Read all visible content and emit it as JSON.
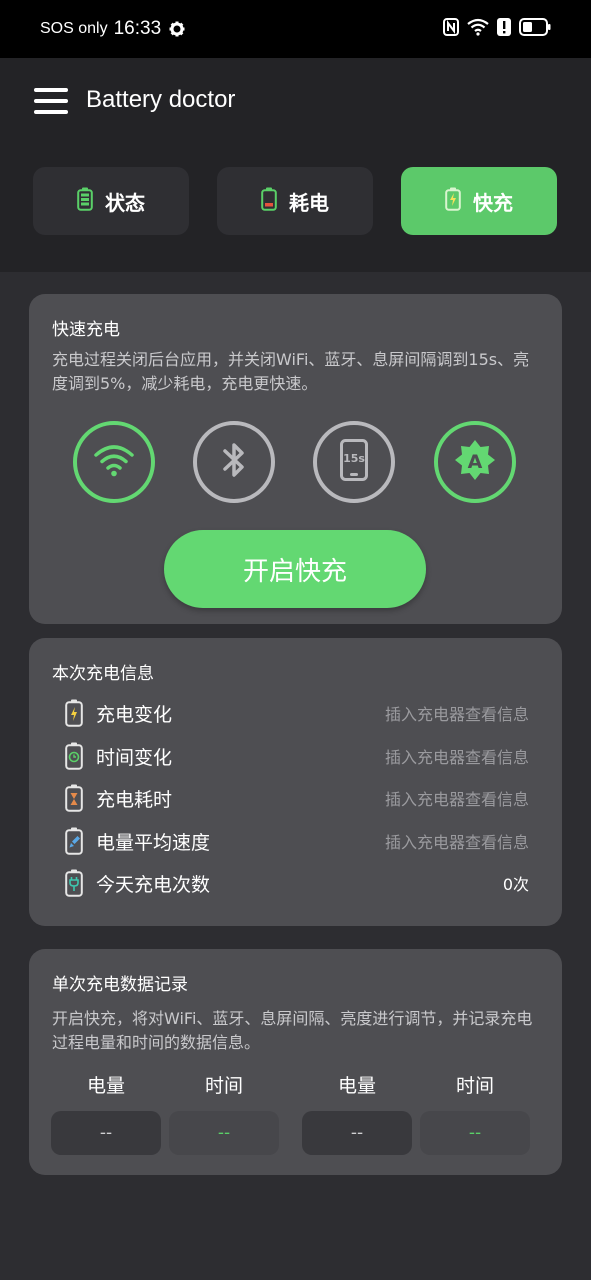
{
  "status_bar": {
    "carrier": "SOS only",
    "time": "16:33"
  },
  "header": {
    "title": "Battery doctor",
    "tabs": [
      {
        "label": "状态",
        "icon": "battery-status-icon",
        "active": false
      },
      {
        "label": "耗电",
        "icon": "battery-drain-icon",
        "active": false
      },
      {
        "label": "快充",
        "icon": "battery-charging-icon",
        "active": true
      }
    ]
  },
  "fast_charge": {
    "title": "快速充电",
    "description": "充电过程关闭后台应用，并关闭WiFi、蓝牙、息屏间隔调到15s、亮度调到5%，减少耗电，充电更快速。",
    "toggles": [
      {
        "name": "wifi-icon",
        "enabled": true
      },
      {
        "name": "bluetooth-icon",
        "enabled": false
      },
      {
        "name": "screen-timeout-icon",
        "label": "15s",
        "enabled": false
      },
      {
        "name": "auto-brightness-icon",
        "label": "A",
        "enabled": true
      }
    ],
    "button_label": "开启快充"
  },
  "charge_info": {
    "title": "本次充电信息",
    "rows": [
      {
        "label": "充电变化",
        "value": "插入充电器查看信息",
        "icon": "battery-bolt-icon"
      },
      {
        "label": "时间变化",
        "value": "插入充电器查看信息",
        "icon": "battery-clock-icon"
      },
      {
        "label": "充电耗时",
        "value": "插入充电器查看信息",
        "icon": "battery-hourglass-icon"
      },
      {
        "label": "电量平均速度",
        "value": "插入充电器查看信息",
        "icon": "battery-rocket-icon"
      },
      {
        "label": "今天充电次数",
        "value": "0次",
        "icon": "battery-plug-icon"
      }
    ]
  },
  "records": {
    "title": "单次充电数据记录",
    "description": "开启快充，将对WiFi、蓝牙、息屏间隔、亮度进行调节，并记录充电过程电量和时间的数据信息。",
    "columns": [
      "电量",
      "时间",
      "电量",
      "时间"
    ],
    "values": [
      "--",
      "--",
      "--",
      "--"
    ]
  },
  "colors": {
    "accent": "#63d872",
    "tab_active": "#5cc96a",
    "card": "#4e4e52",
    "header": "#232326"
  }
}
